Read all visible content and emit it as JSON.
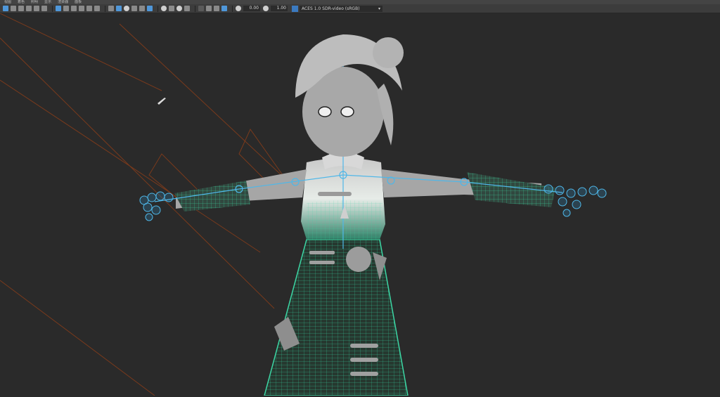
{
  "menu": {
    "items": [
      "视图",
      "着色",
      "照明",
      "显示",
      "渲染器",
      "面板"
    ]
  },
  "toolbar": {
    "camera_exposure": "0.00",
    "camera_gamma": "1.00",
    "color_space": "ACES 1.0 SDR-video (sRGB)",
    "icons": [
      "select-camera-icon",
      "camera-attributes-icon",
      "bookmark-icon",
      "image-plane-icon",
      "grid-icon",
      "film-gate-icon",
      "resolution-gate-icon",
      "gate-mask-icon",
      "field-chart-icon",
      "safe-action-icon",
      "wireframe-icon",
      "smooth-shade-icon",
      "textured-icon",
      "lighting-icon",
      "shadows-icon",
      "ambient-occlusion-icon",
      "motion-blur-icon",
      "isolate-select-icon",
      "xray-icon",
      "xray-joints-icon",
      "backface-culling-icon",
      "exposure-icon",
      "gamma-icon",
      "color-management-icon"
    ]
  },
  "viewport": {
    "background": "#2a2a2a",
    "guide_line_color": "#7a3a1c",
    "wireframe_color": "#3cd6a4",
    "joint_color": "#4fb7e8",
    "mesh_color": "#9a9a9a"
  }
}
